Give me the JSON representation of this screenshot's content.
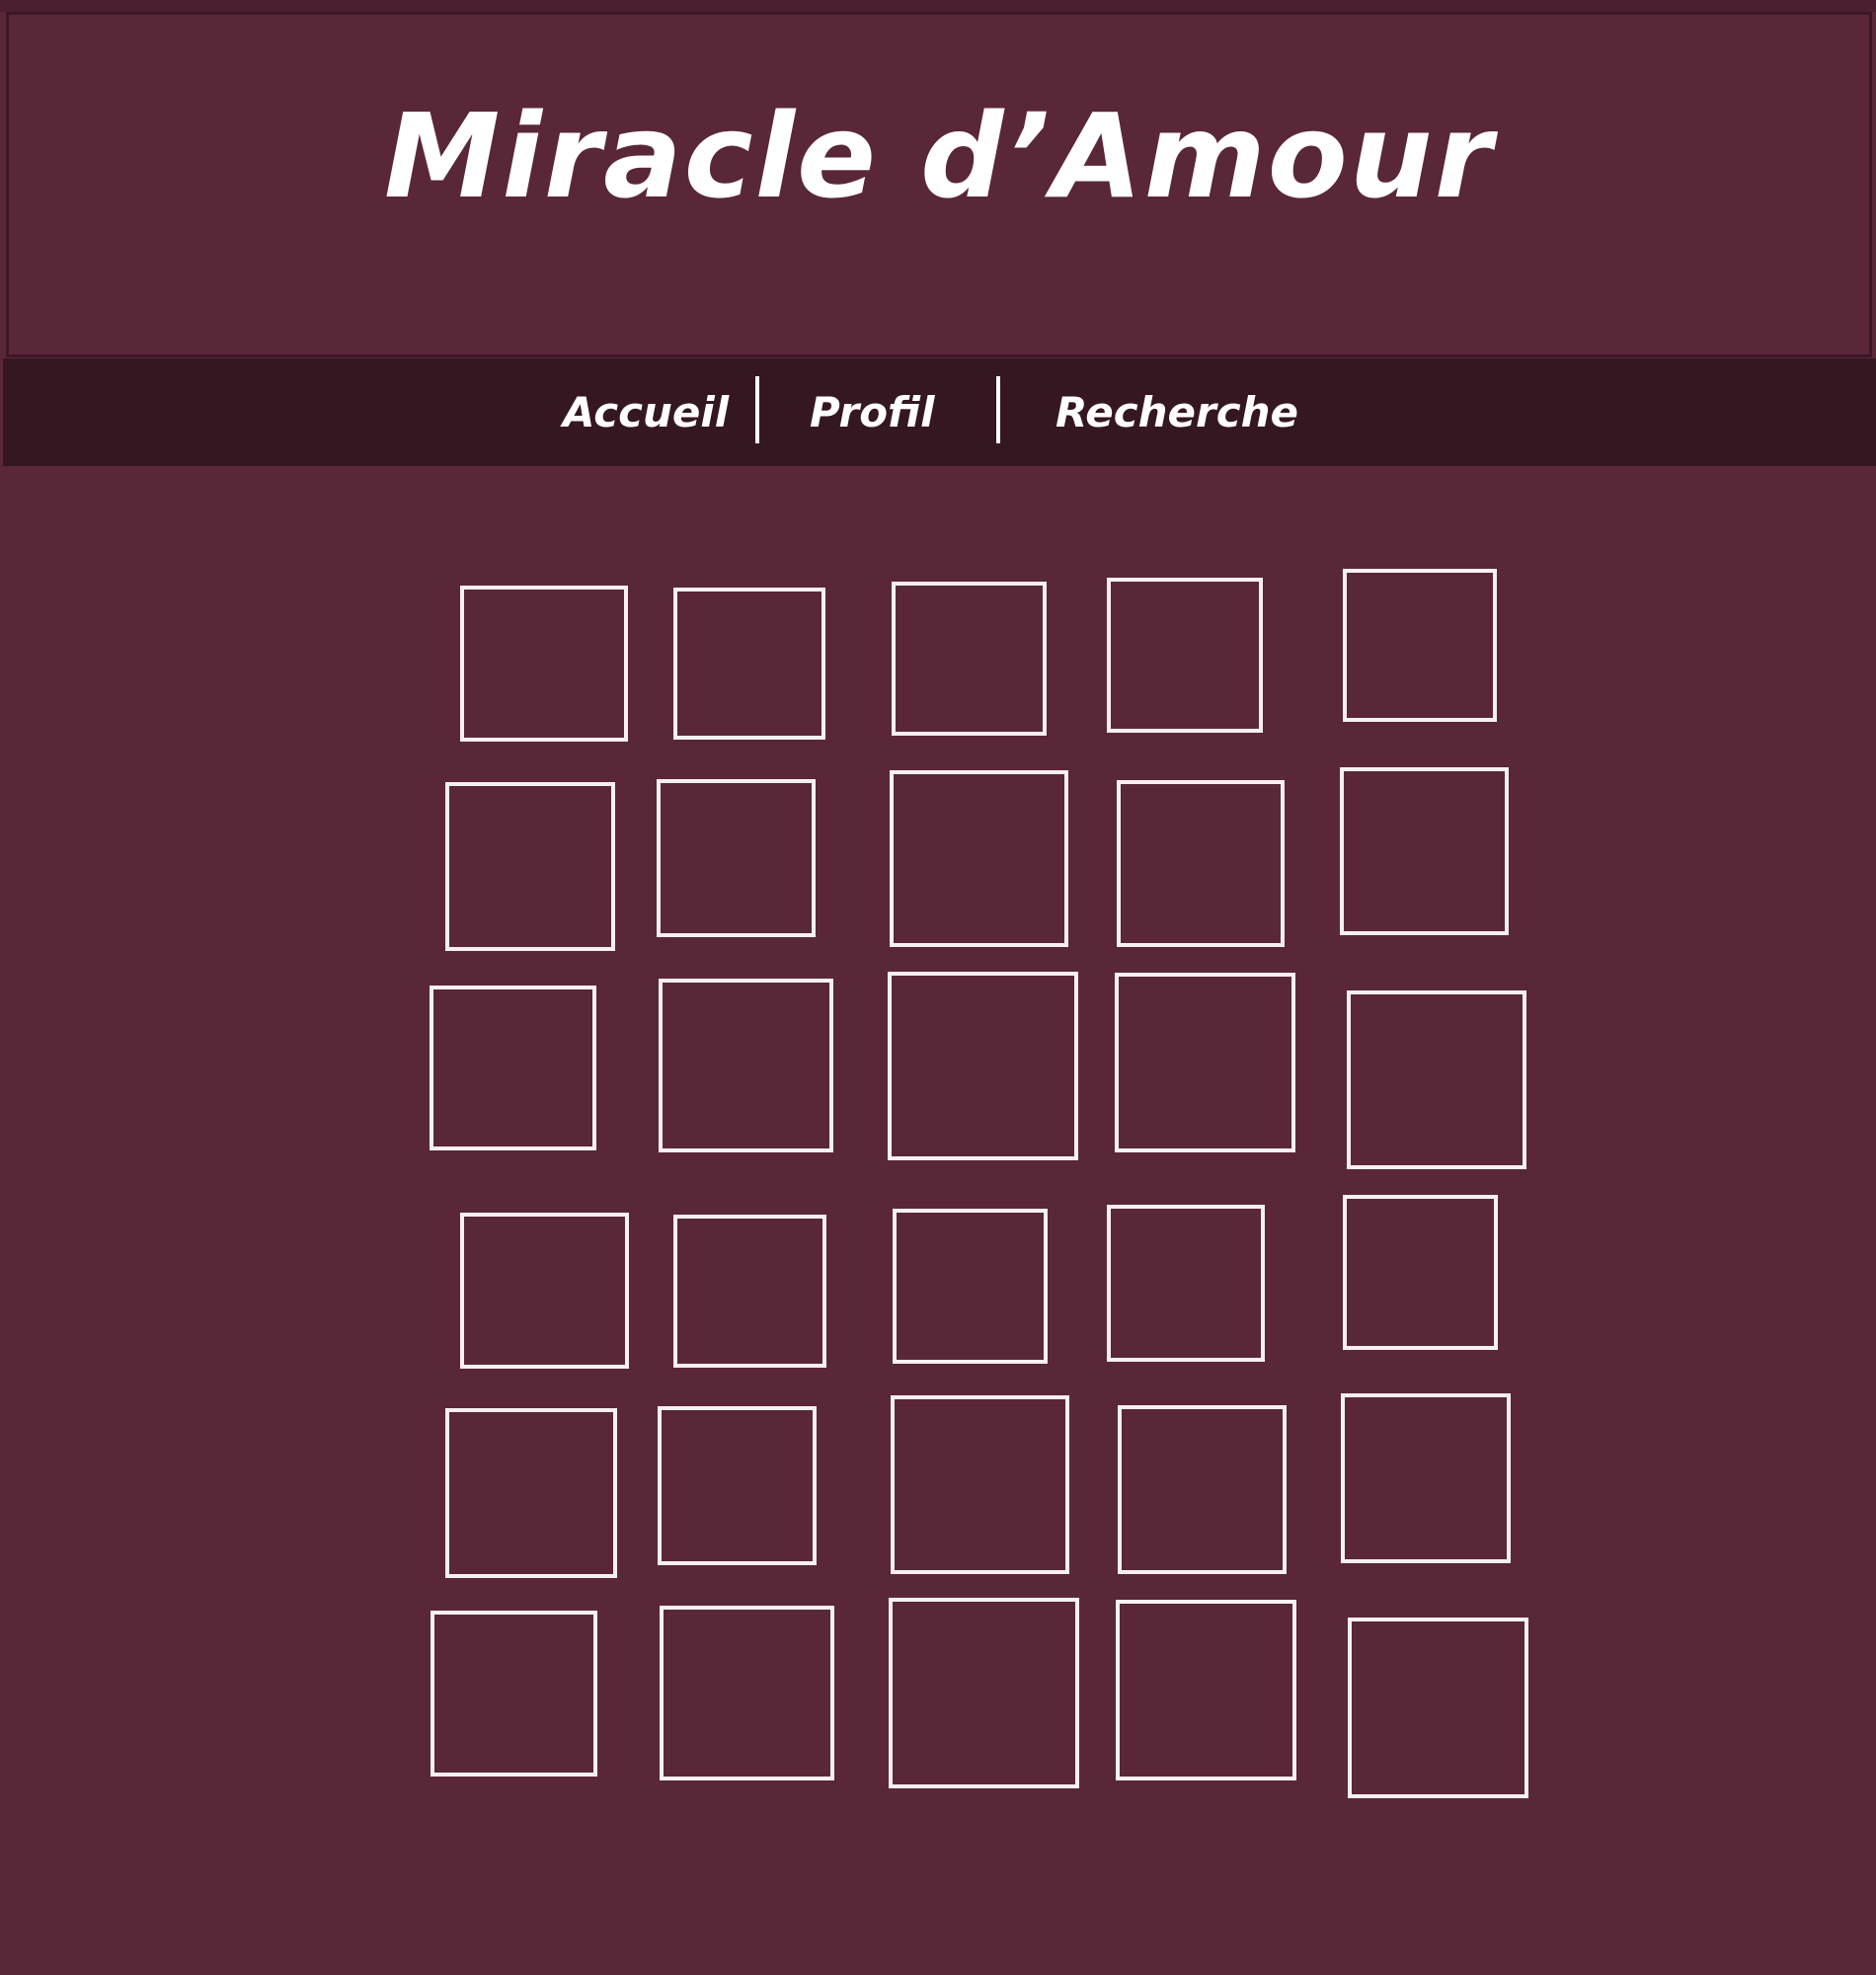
{
  "site": {
    "title": "Miracle d’Amour"
  },
  "nav": {
    "items": [
      {
        "label": "Accueil"
      },
      {
        "label": "Profil"
      },
      {
        "label": "Recherche"
      }
    ]
  },
  "colors": {
    "background": "#5a2739",
    "nav_background": "#351722",
    "box_outline": "#f6f0f2",
    "text": "#ffffff"
  },
  "grid": {
    "rows": 6,
    "columns": 5,
    "cells": 30
  }
}
